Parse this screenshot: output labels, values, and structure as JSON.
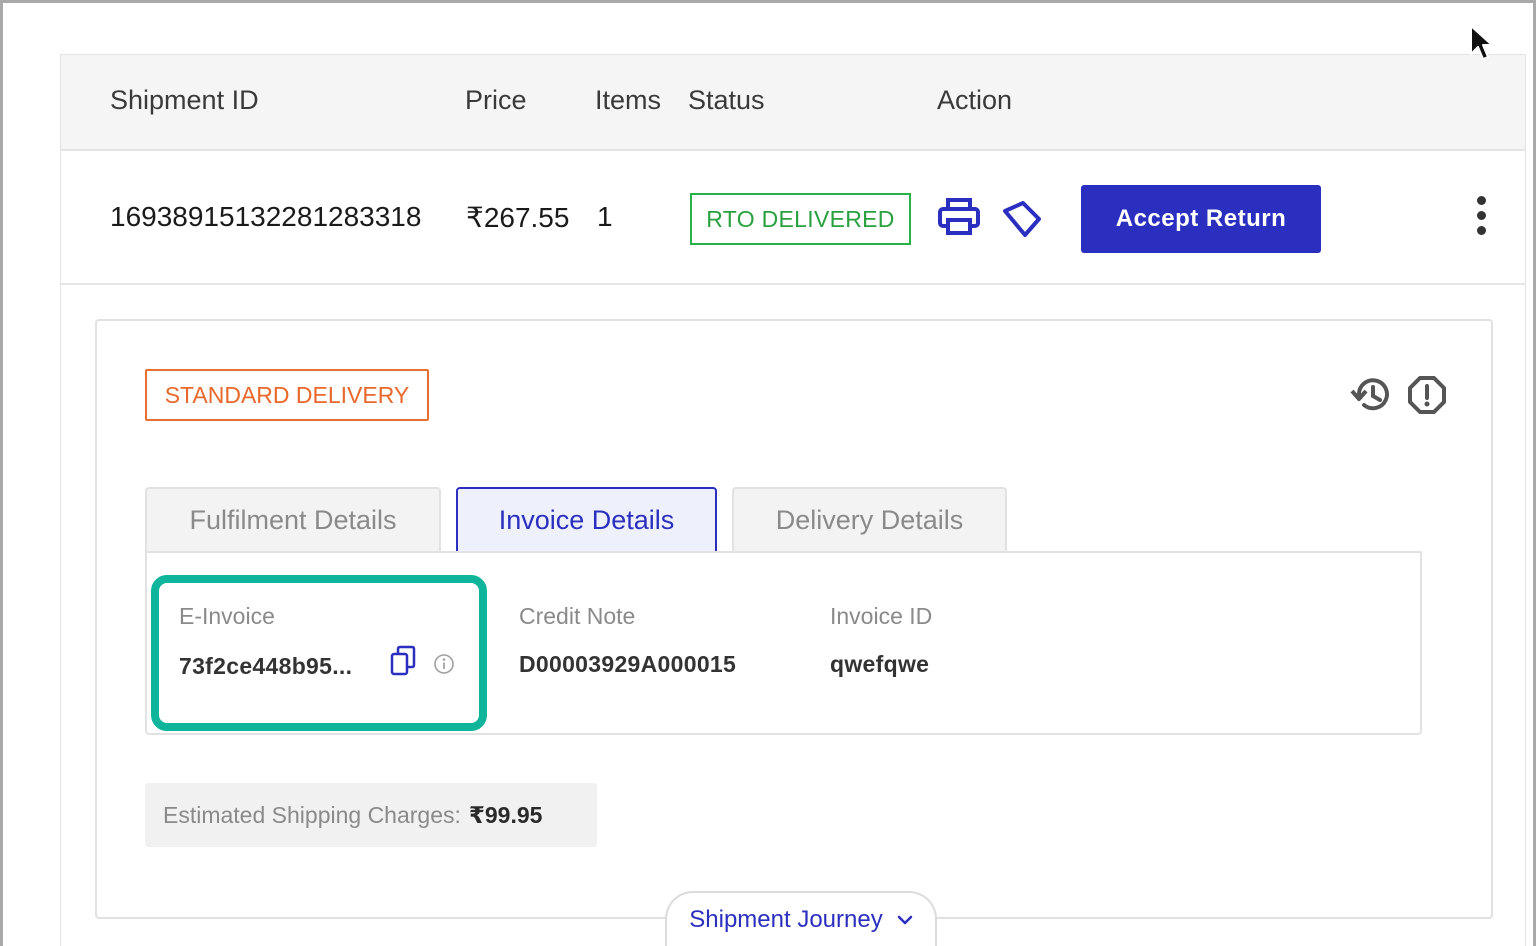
{
  "table": {
    "headers": {
      "shipment_id": "Shipment ID",
      "price": "Price",
      "items": "Items",
      "status": "Status",
      "action": "Action"
    },
    "row": {
      "shipment_id": "16938915132281283318",
      "price": "₹267.55",
      "items": "1",
      "status": "RTO DELIVERED",
      "status_color": "#2aa13f",
      "accept_label": "Accept Return"
    }
  },
  "icons": {
    "print": "printer-icon",
    "label": "tag-icon",
    "history": "history-icon",
    "report": "alert-octagon-icon",
    "copy": "copy-icon",
    "info": "info-icon",
    "more": "kebab-menu-icon",
    "chevron": "chevron-down-icon"
  },
  "details": {
    "delivery_type": "STANDARD DELIVERY",
    "tabs": [
      {
        "label": "Fulfilment Details",
        "active": false
      },
      {
        "label": "Invoice Details",
        "active": true
      },
      {
        "label": "Delivery Details",
        "active": false
      }
    ],
    "invoice": {
      "e_invoice_label": "E-Invoice",
      "e_invoice_value": "73f2ce448b95...",
      "credit_note_label": "Credit Note",
      "credit_note_value": "D00003929A000015",
      "invoice_id_label": "Invoice ID",
      "invoice_id_value": "qwefqwe"
    },
    "shipping_label": "Estimated Shipping Charges:",
    "shipping_value": "₹99.95",
    "journey_label": "Shipment Journey"
  },
  "colors": {
    "brand": "#2b2fbf",
    "status_green": "#2aa13f",
    "delivery_orange": "#e8692b",
    "highlight_teal": "#0eb59b"
  }
}
